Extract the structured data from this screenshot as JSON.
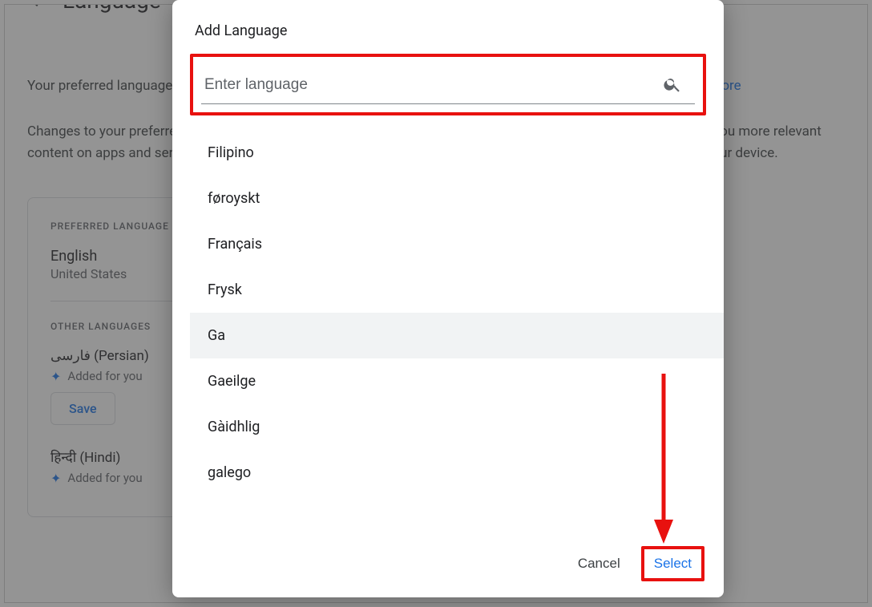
{
  "backdrop": {
    "page_title": "Language",
    "intro": "Your preferred languages are used to personalize your experience across Google and help you understand. ",
    "learn_more": "Learn more",
    "changes": "Changes to your preferred language are reflected on the web. Google may use your language information to show you more relevant content on apps and services. To change the preferred language for mobile apps, go to the language settings on your device.",
    "preferred_label": "PREFERRED LANGUAGE",
    "preferred_lang": "English",
    "preferred_region": "United States",
    "other_label": "OTHER LANGUAGES",
    "other": [
      {
        "name": "فارسی (Persian)",
        "added": "Added for you"
      },
      {
        "name": "हिन्दी (Hindi)",
        "added": "Added for you"
      }
    ],
    "save": "Save"
  },
  "modal": {
    "title": "Add Language",
    "search_placeholder": "Enter language",
    "languages": [
      "Filipino",
      "føroyskt",
      "Français",
      "Frysk",
      "Ga",
      "Gaeilge",
      "Gàidhlig",
      "galego"
    ],
    "hovered_index": 4,
    "cancel": "Cancel",
    "select": "Select"
  }
}
